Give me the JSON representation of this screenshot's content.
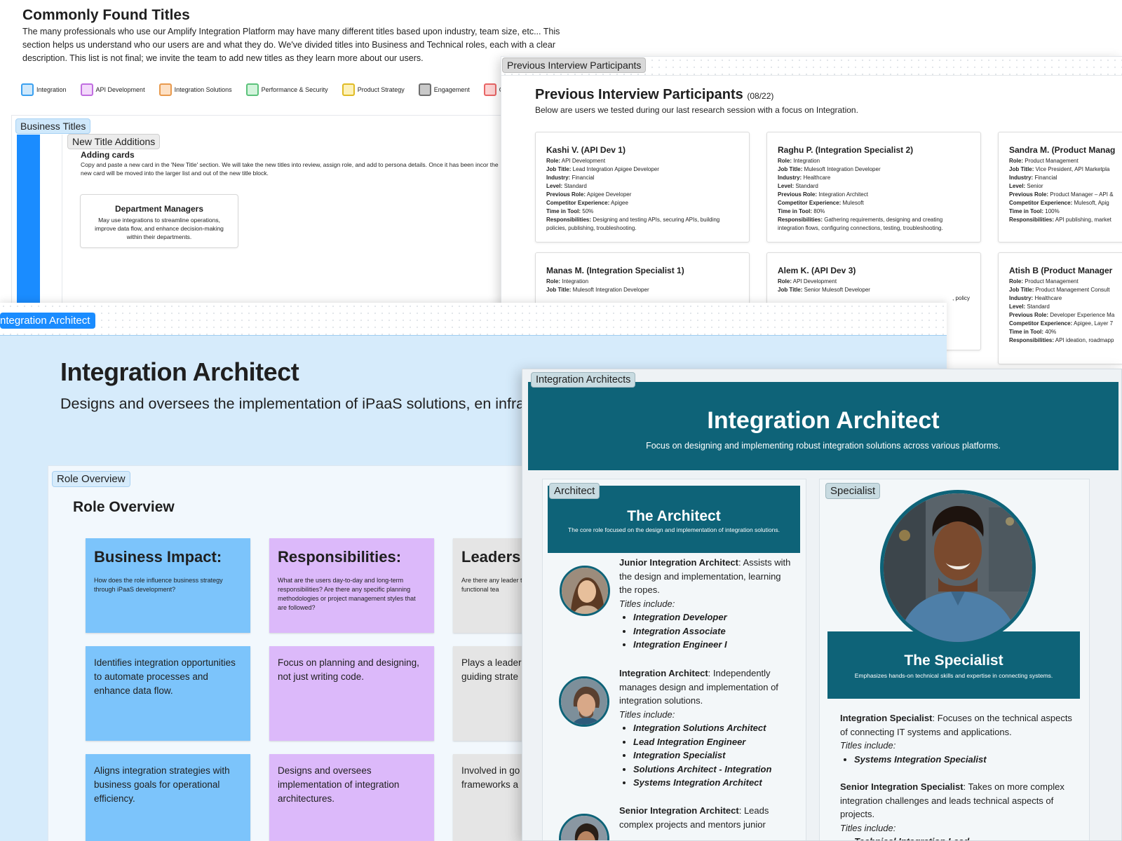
{
  "titles_section": {
    "title": "Commonly Found Titles",
    "description": "The many professionals who use our Amplify Integration Platform may have many different titles based upon industry, team size, etc... This section helps us understand who our users are and what they do. We've divided titles into Business and Technical roles, each with a clear description. This list is not final; we invite the team to add new titles as they learn more about our users.",
    "legend": [
      {
        "label": "Integration",
        "fill": "#cfe8fb",
        "border": "#3aa0f0"
      },
      {
        "label": "API Development",
        "fill": "#f3d9fb",
        "border": "#c06ee0"
      },
      {
        "label": "Integration Solutions",
        "fill": "#fde0c4",
        "border": "#e89a4e"
      },
      {
        "label": "Performance & Security",
        "fill": "#d3f4dc",
        "border": "#5cc27b"
      },
      {
        "label": "Product Strategy",
        "fill": "#fdf1b8",
        "border": "#e0bb25"
      },
      {
        "label": "Engagement",
        "fill": "#c9c9c9",
        "border": "#6e6e6e"
      },
      {
        "label": "Ope",
        "fill": "#fcd2d2",
        "border": "#e86565"
      }
    ],
    "business_titles_label": "Business Titles",
    "new_title_label": "New Title Additions",
    "adding_cards_title": "Adding cards",
    "adding_cards_text": "Copy and paste a new card in the 'New Title' section. We will take the new titles into review, assign role, and add to persona details. Once it has been incor the new card will be moved into the larger list and out of the new title block.",
    "dept_card": {
      "title": "Department Managers",
      "desc": "May use integrations to streamline operations, improve data flow, and enhance decision-making within their departments."
    }
  },
  "participants": {
    "frame_label": "Previous Interview Participants",
    "title": "Previous Interview Participants",
    "count": "(08/22)",
    "subtitle": "Below are users we tested during our last research session with a focus on Integration.",
    "field_labels": {
      "role": "Role:",
      "job": "Job Title:",
      "industry": "Industry:",
      "level": "Level:",
      "prev": "Previous Role:",
      "comp": "Competitor Experience:",
      "time": "Time in Tool:",
      "resp": "Responsibilities:"
    },
    "cards": [
      {
        "name": "Kashi V. (API Dev 1)",
        "role": "API Development",
        "job": "Lead Integration Apigee Developer",
        "industry": "Financial",
        "level": "Standard",
        "prev": "Apigee Developer",
        "comp": "Apigee",
        "time": "50%",
        "resp": "Designing and testing APIs, securing APIs, building policies, publishing, troubleshooting."
      },
      {
        "name": "Raghu P. (Integration Specialist 2)",
        "role": "Integration",
        "job": "Mulesoft Integration Developer",
        "industry": "Healthcare",
        "level": "Standard",
        "prev": "Integration Architect",
        "comp": "Mulesoft",
        "time": "80%",
        "resp": "Gathering requirements, designing and creating integration flows, configuring connections, testing, troubleshooting."
      },
      {
        "name": "Sandra M. (Product Manag",
        "role": "Product Management",
        "job": "Vice President, API Marketpla",
        "industry": "Financial",
        "level": "Senior",
        "prev": "Product Manager – API &",
        "comp": "Mulesoft, Apig",
        "time": "100%",
        "resp": "API publishing, market"
      },
      {
        "name": "Manas M. (Integration Specialist 1)",
        "role": "Integration",
        "job": "Mulesoft Integration Developer",
        "industry": "",
        "level": "",
        "prev": "",
        "comp": "",
        "time": "",
        "resp": ""
      },
      {
        "name": "Alem K. (API Dev 3)",
        "role": "API Development",
        "job": "Senior Mulesoft Developer",
        "industry": "",
        "level": "",
        "prev": "",
        "comp": "",
        "time": "",
        "resp": ", policy"
      },
      {
        "name": "Atish B (Product Manager",
        "role": "Product Management",
        "job": "Product Management Consult",
        "industry": "Healthcare",
        "level": "Standard",
        "prev": "Developer Experience Ma",
        "comp": "Apigee, Layer 7",
        "time": "40%",
        "resp": "API ideation, roadmapp"
      }
    ]
  },
  "architect_page": {
    "frame_label": "ntegration Architect",
    "title": "Integration Architect",
    "description": "Designs and oversees the implementation of iPaaS solutions, en infrastructure.",
    "role_overview_label": "Role Overview",
    "role_overview_title": "Role Overview",
    "columns": [
      {
        "heading": "Business Impact:",
        "question": "How does the role influence business strategy through iPaaS development?",
        "color": "#7cc4fb",
        "notes": [
          "Identifies integration opportunities to automate processes and enhance data flow.",
          "Aligns integration strategies with business goals for operational efficiency."
        ]
      },
      {
        "heading": "Responsibilities:",
        "question": "What are the users day-to-day and long-term responsibilities? Are there any specific planning methodologies or project management styles that are followed?",
        "color": "#dcb9fa",
        "notes": [
          "Focus on planning and designing, not just writing code.",
          "Designs and oversees implementation of integration architectures."
        ]
      },
      {
        "heading": "Leaders",
        "question": "Are there any leader techniques pertinen cross-functional tea",
        "color": "#e5e5e5",
        "notes": [
          "Plays a leader enterprise iPa guiding strate",
          "Involved in go projects appro frameworks a"
        ]
      }
    ]
  },
  "architects_board": {
    "frame_label": "Integration Architects",
    "title": "Integration Architect",
    "subtitle": "Focus on designing and implementing robust integration solutions across various platforms.",
    "architect": {
      "label": "Architect",
      "title": "The Architect",
      "subtitle": "The core role focused on the design and implementation of integration solutions.",
      "titles_include": "Titles include:",
      "roles": [
        {
          "name": "Junior Integration Architect",
          "desc": ": Assists with the design and implementation, learning the ropes.",
          "titles": [
            "Integration Developer",
            "Integration Associate",
            "Integration Engineer I"
          ]
        },
        {
          "name": "Integration Architect",
          "desc": ": Independently manages design and implementation of integration solutions.",
          "titles": [
            "Integration Solutions Architect",
            "Lead Integration Engineer",
            "Integration Specialist",
            "Solutions Architect - Integration",
            "Systems Integration Architect"
          ]
        },
        {
          "name": "Senior Integration Architect",
          "desc": ": Leads complex projects and mentors junior",
          "titles": []
        }
      ]
    },
    "specialist": {
      "label": "Specialist",
      "title": "The Specialist",
      "subtitle": "Emphasizes hands-on technical skills and expertise in connecting systems.",
      "titles_include": "Titles include:",
      "roles": [
        {
          "name": "Integration Specialist",
          "desc": ": Focuses on the technical aspects of connecting IT systems and applications.",
          "titles": [
            "Systems Integration Specialist"
          ]
        },
        {
          "name": "Senior Integration Specialist",
          "desc": ": Takes on more complex integration challenges and leads technical aspects of projects.",
          "titles": [
            "Technical Integration Lead"
          ]
        }
      ]
    }
  }
}
